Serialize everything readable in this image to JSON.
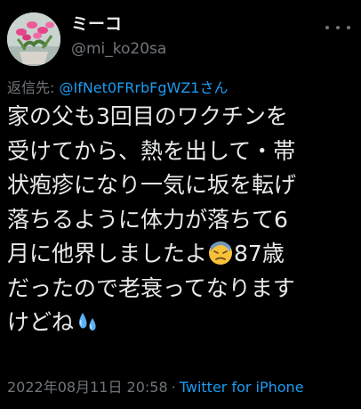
{
  "author": {
    "display_name": "ミーコ",
    "handle": "@mi_ko20sa",
    "avatar_icon": "christmas-cactus-flower-photo"
  },
  "reply": {
    "prefix": "返信先: ",
    "target": "@IfNet0FRrbFgWZ1さん"
  },
  "tweet": {
    "lines": [
      "家の父も3回目のワクチンを",
      "受けてから、熱を出して・帯",
      "状疱疹になり一気に坂を転げ",
      "落ちるように体力が落ちて6",
      "月に他界しましたよ",
      "87歳",
      "だったので老衰ってなります",
      "けどね"
    ],
    "emoji_1": "sad-sweat-face-emoji",
    "emoji_2": "sweat-droplets-emoji"
  },
  "meta": {
    "date": "2022年08月11日 20:58",
    "separator": "·",
    "source": "Twitter for iPhone"
  },
  "colors": {
    "background": "#000000",
    "text": "#e7e9ea",
    "muted": "#71767b",
    "link": "#1d9bf0"
  }
}
